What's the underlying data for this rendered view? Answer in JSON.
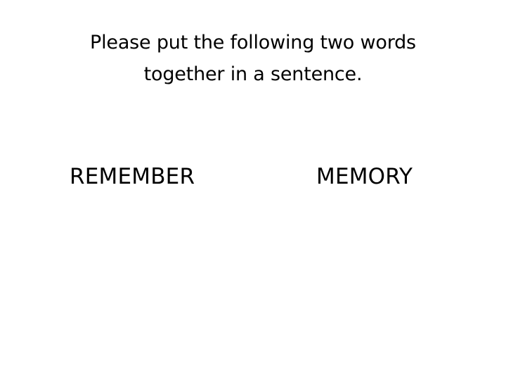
{
  "slide": {
    "title_line1": "Please put the following two words",
    "title_line2": "together in a sentence.",
    "word_left": "REMEMBER",
    "word_right": "MEMORY"
  }
}
